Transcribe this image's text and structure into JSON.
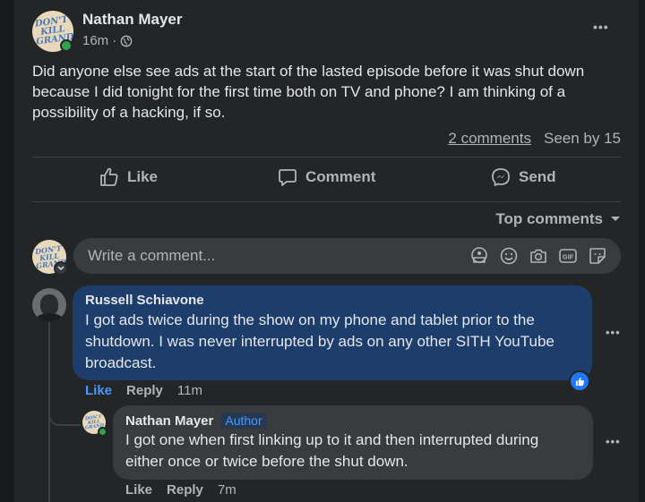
{
  "post": {
    "author": "Nathan Mayer",
    "avatar_text": "DON'T KILL GRAND",
    "time": "16m",
    "separator": "·",
    "privacy_icon": "globe-icon",
    "more_icon": "more-dots-icon",
    "more_label": "•••",
    "text": "Did anyone else see ads at the start of the lasted episode before it was shut down because I did tonight for the first time both on TV and phone? I am thinking of a possibility of a hacking, if so.",
    "comments_count": "2 comments",
    "seen_by": "Seen by 15"
  },
  "actions": {
    "like": "Like",
    "comment": "Comment",
    "send": "Send"
  },
  "sort": {
    "label": "Top comments"
  },
  "composer": {
    "placeholder": "Write a comment...",
    "avatar_text": "DON'T KILL GRAND",
    "icons": [
      "avatar-sticker-icon",
      "emoji-icon",
      "camera-icon",
      "gif-icon",
      "sticker-icon"
    ]
  },
  "comments": [
    {
      "author": "Russell Schiavone",
      "text": "I got ads twice during the show on my phone and tablet prior to the shutdown. I was never interrupted by ads on any other SITH YouTube broadcast.",
      "like_label": "Like",
      "reply_label": "Reply",
      "time": "11m",
      "more_label": "•••",
      "reaction": "like-reaction"
    },
    {
      "author": "Nathan Mayer",
      "badge": "Author",
      "avatar_text": "DON'T KILL GRAND",
      "text": "I got one when first linking up to it and then interrupted during either once or twice before the shut down.",
      "like_label": "Like",
      "reply_label": "Reply",
      "time": "7m",
      "more_label": "•••"
    }
  ],
  "colors": {
    "background": "#18191a",
    "card": "#242526",
    "comment_bubble_highlight": "#1d3e6b",
    "comment_bubble": "#3a3b3c",
    "accent": "#2078f4",
    "online": "#31a24c"
  }
}
